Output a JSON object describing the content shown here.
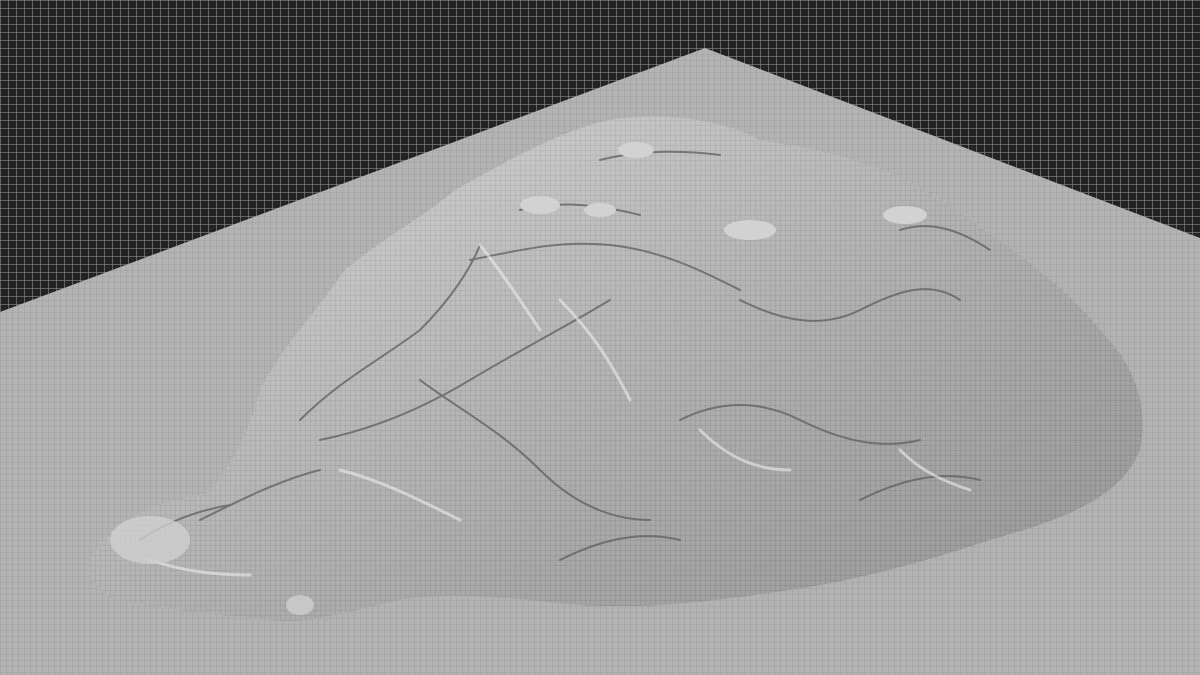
{
  "viewport": {
    "background_color": "#232323",
    "grid_line_color": "#969696",
    "plane_color": "#b4b4b4",
    "terrain_light_color": "#d9d9d9",
    "terrain_shadow_color": "#6e6e6e",
    "wire_color": "#5a5a5a"
  },
  "icons": [
    "terrain-mesh-icon"
  ]
}
